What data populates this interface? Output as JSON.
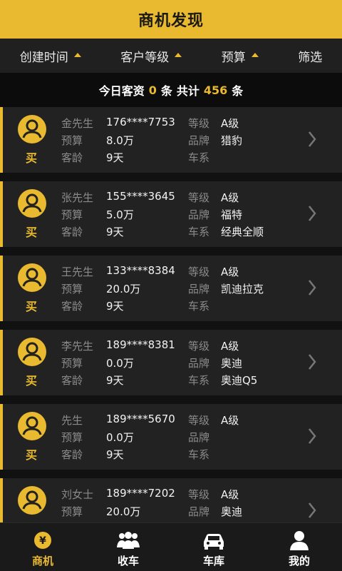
{
  "header": {
    "title": "商机发现"
  },
  "filters": [
    {
      "label": "创建时间",
      "arrow": true
    },
    {
      "label": "客户等级",
      "arrow": true
    },
    {
      "label": "预算",
      "arrow": true
    },
    {
      "label": "筛选",
      "arrow": false
    }
  ],
  "summary": {
    "prefix": "今日客资",
    "today_count": "0",
    "unit1": "条",
    "total_label": "共计",
    "total_count": "456",
    "unit2": "条"
  },
  "labels": {
    "budget": "预算",
    "age": "客龄",
    "level": "等级",
    "brand": "品牌",
    "series": "车系",
    "buy": "买"
  },
  "leads": [
    {
      "name": "金先生",
      "phone": "176****7753",
      "level": "A级",
      "budget": "8.0万",
      "brand": "猎豹",
      "age": "9天",
      "series": ""
    },
    {
      "name": "张先生",
      "phone": "155****3645",
      "level": "A级",
      "budget": "5.0万",
      "brand": "福特",
      "age": "9天",
      "series": "经典全顺"
    },
    {
      "name": "王先生",
      "phone": "133****8384",
      "level": "A级",
      "budget": "20.0万",
      "brand": "凯迪拉克",
      "age": "9天",
      "series": ""
    },
    {
      "name": "李先生",
      "phone": "189****8381",
      "level": "A级",
      "budget": "0.0万",
      "brand": "奥迪",
      "age": "9天",
      "series": "奥迪Q5"
    },
    {
      "name": "先生",
      "phone": "189****5670",
      "level": "A级",
      "budget": "0.0万",
      "brand": "",
      "age": "9天",
      "series": ""
    },
    {
      "name": "刘女士",
      "phone": "189****7202",
      "level": "A级",
      "budget": "20.0万",
      "brand": "奥迪",
      "age": "",
      "series": ""
    }
  ],
  "tabs": [
    {
      "label": "商机",
      "icon": "yen-coin-icon",
      "active": true
    },
    {
      "label": "收车",
      "icon": "group-people-icon",
      "active": false
    },
    {
      "label": "车库",
      "icon": "car-icon",
      "active": false
    },
    {
      "label": "我的",
      "icon": "person-icon",
      "active": false
    }
  ],
  "colors": {
    "accent": "#e9b92f",
    "background": "#111111",
    "card": "#222222"
  }
}
